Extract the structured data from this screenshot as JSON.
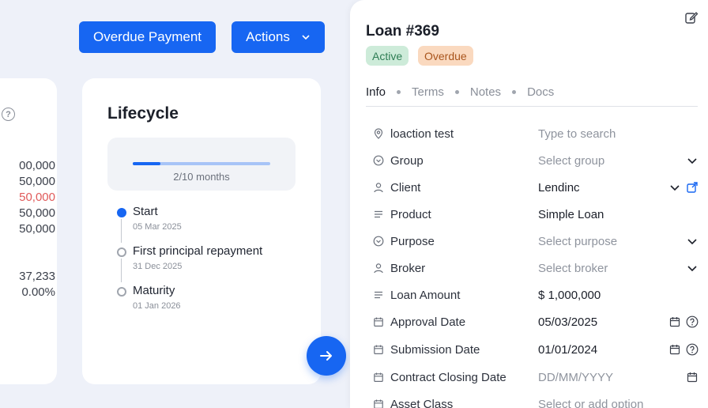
{
  "toolbar": {
    "overdue_label": "Overdue Payment",
    "actions_label": "Actions"
  },
  "left_card": {
    "help": "?",
    "values_top": [
      "00,000",
      "50,000",
      "50,000",
      "50,000",
      "50,000"
    ],
    "values_bottom": [
      "37,233",
      "0.00%"
    ]
  },
  "lifecycle": {
    "title": "Lifecycle",
    "progress_label": "2/10 months",
    "progress_fraction": 0.2,
    "milestones": [
      {
        "name": "Start",
        "date": "05 Mar 2025"
      },
      {
        "name": "First principal repayment",
        "date": "31 Dec 2025"
      },
      {
        "name": "Maturity",
        "date": "01 Jan 2026"
      }
    ]
  },
  "colors": {
    "primary": "#1766f2",
    "danger": "#e05a5a"
  },
  "panel": {
    "title": "Loan #369",
    "badges": {
      "active": "Active",
      "overdue": "Overdue"
    },
    "tabs": [
      "Info",
      "Terms",
      "Notes",
      "Docs"
    ],
    "fields": [
      {
        "label": "loaction test",
        "value": "Type to search",
        "icon": "location-pin-icon"
      },
      {
        "label": "Group",
        "value": "Select group",
        "icon": "chevron-circle-icon"
      },
      {
        "label": "Client",
        "value": "Lendinc",
        "icon": "user-icon"
      },
      {
        "label": "Product",
        "value": "Simple Loan",
        "icon": "lines-icon"
      },
      {
        "label": "Purpose",
        "value": "Select purpose",
        "icon": "chevron-circle-icon"
      },
      {
        "label": "Broker",
        "value": "Select broker",
        "icon": "user-icon"
      },
      {
        "label": "Loan Amount",
        "value": "$ 1,000,000",
        "icon": "lines-icon"
      },
      {
        "label": "Approval Date",
        "value": "05/03/2025",
        "icon": "calendar-icon"
      },
      {
        "label": "Submission Date",
        "value": "01/01/2024",
        "icon": "calendar-icon"
      },
      {
        "label": "Contract Closing Date",
        "value": "DD/MM/YYYY",
        "icon": "calendar-icon"
      },
      {
        "label": "Asset Class",
        "value": "Select or add option",
        "icon": "calendar-icon"
      }
    ]
  }
}
